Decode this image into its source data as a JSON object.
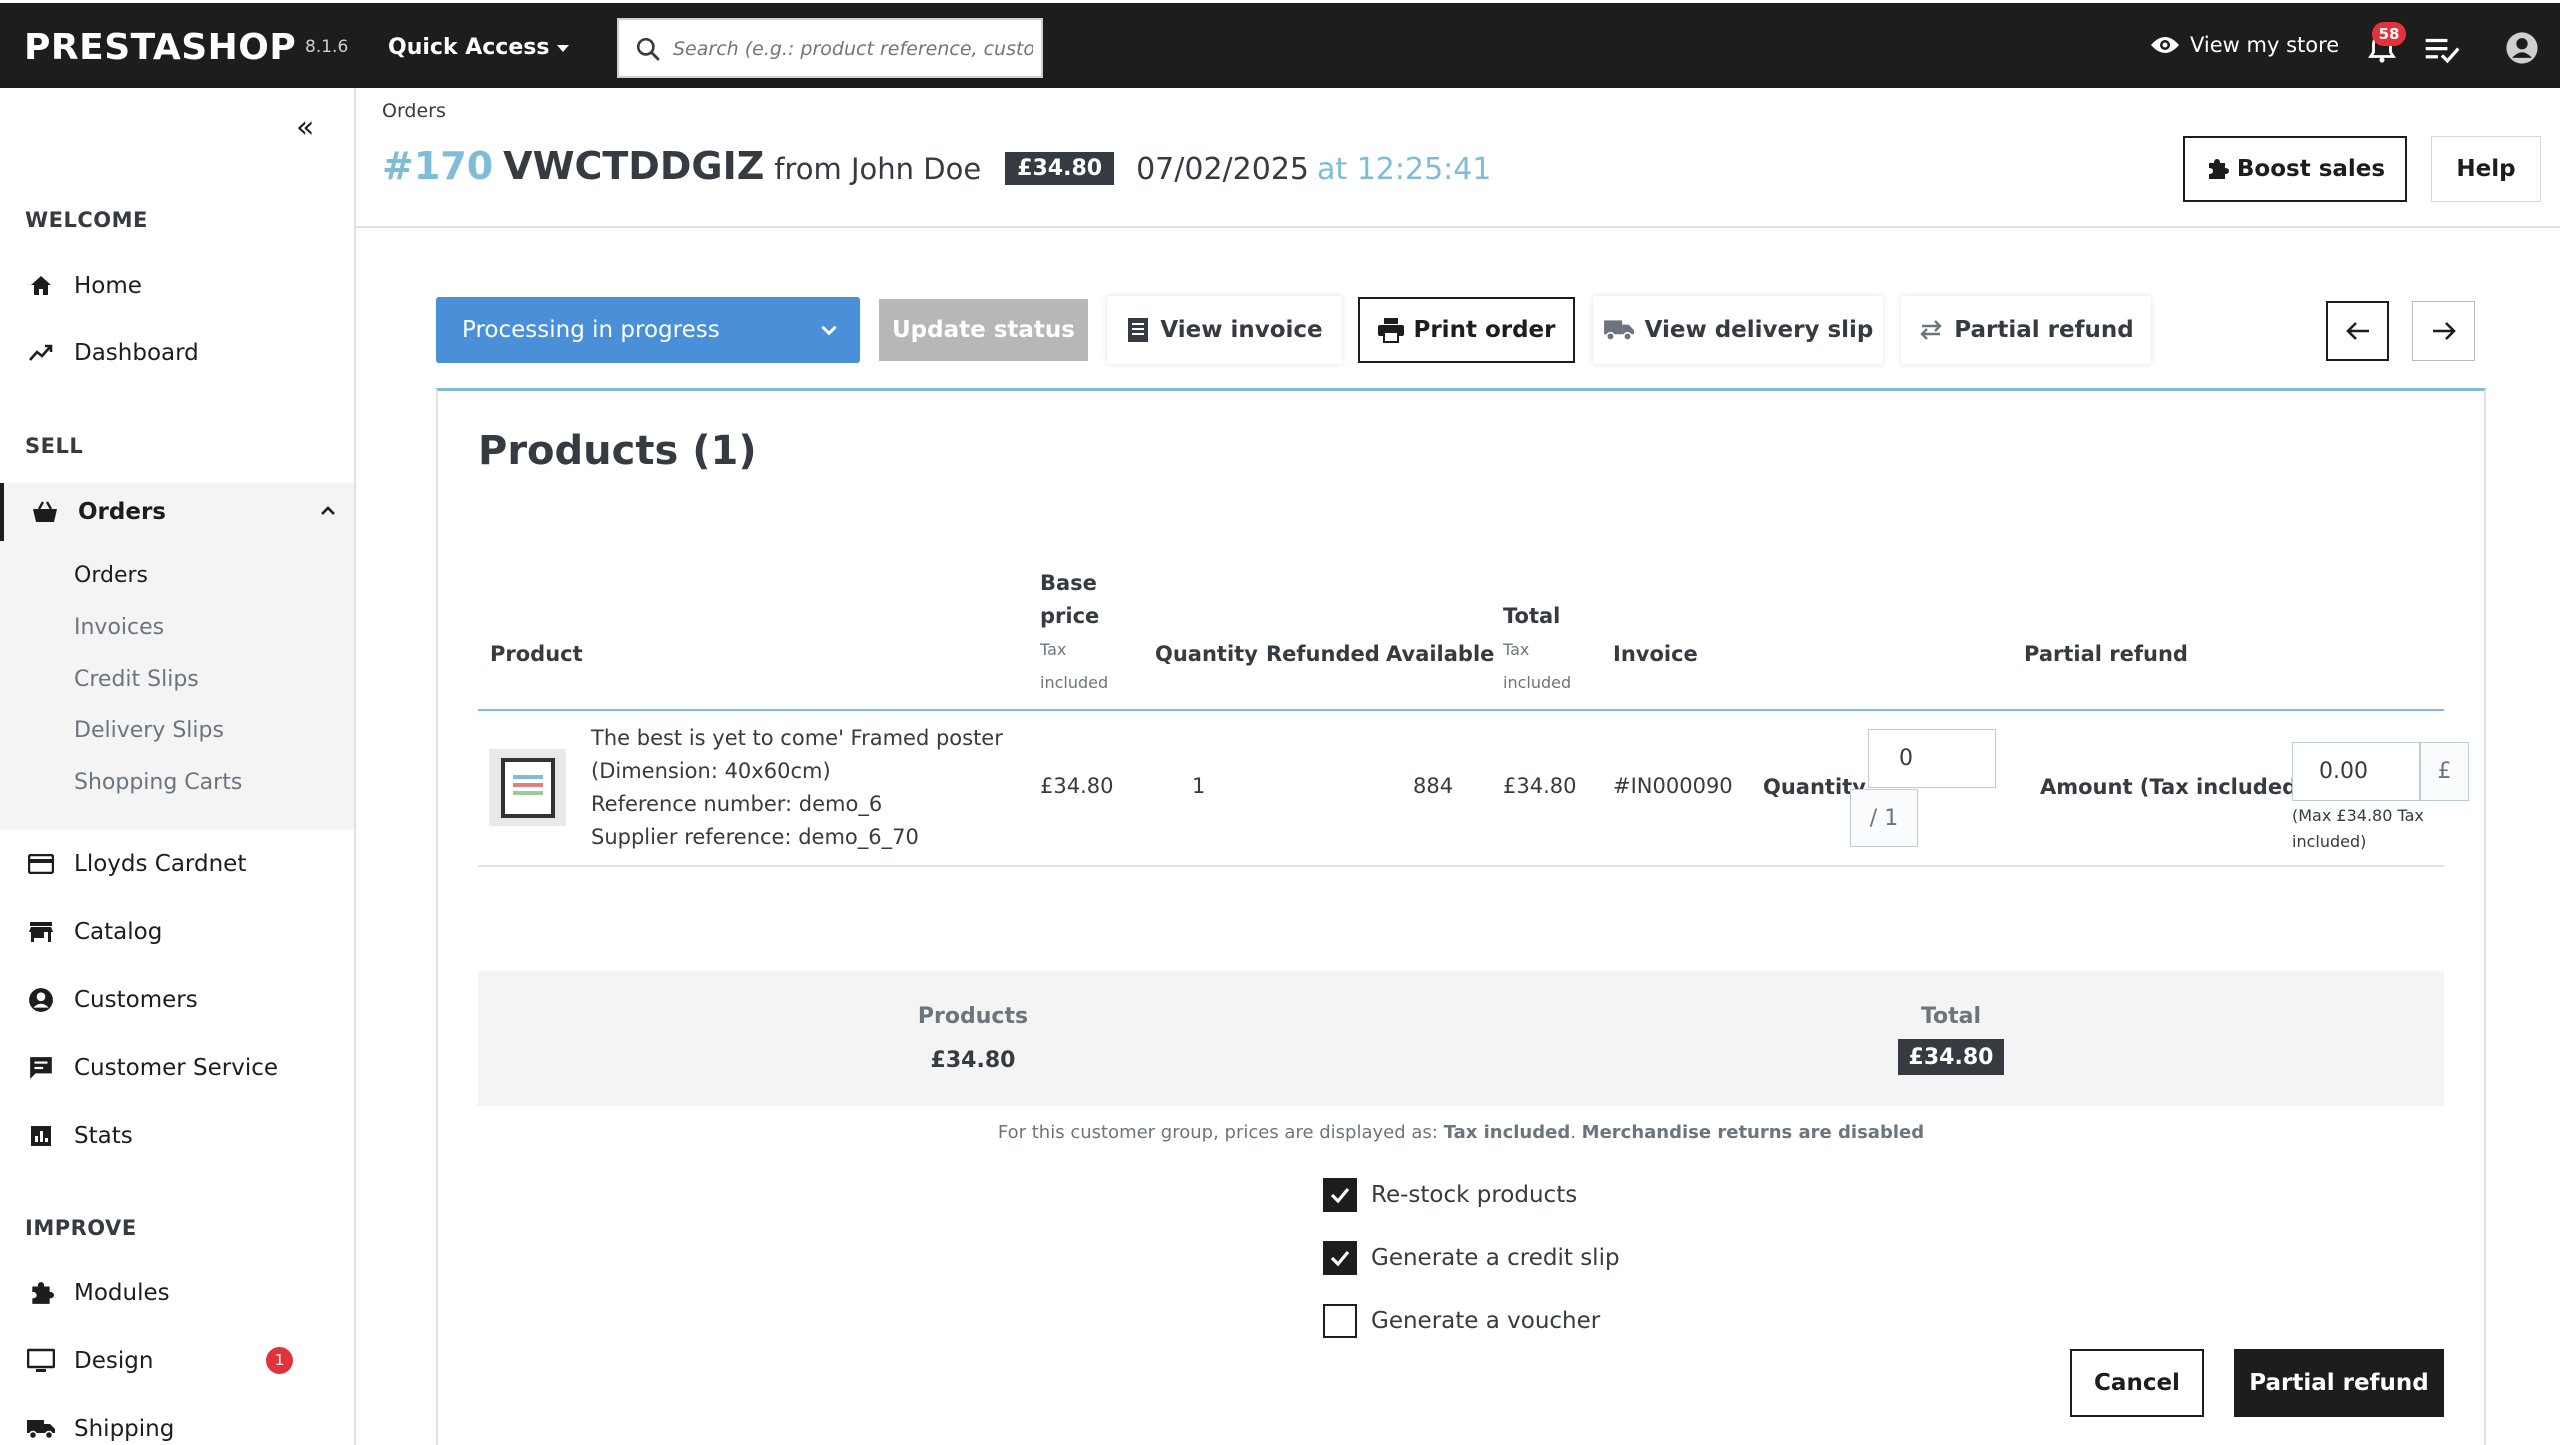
{
  "topbar": {
    "logo": "PRESTASHOP",
    "version": "8.1.6",
    "quick_access": "Quick Access",
    "search_placeholder": "Search (e.g.: product reference, custor",
    "view_store": "View my store",
    "notifications_count": "58"
  },
  "sidebar": {
    "sections": {
      "welcome": "WELCOME",
      "sell": "SELL",
      "improve": "IMPROVE"
    },
    "items": {
      "home": "Home",
      "dashboard": "Dashboard",
      "orders": "Orders",
      "lloyds": "Lloyds Cardnet",
      "catalog": "Catalog",
      "customers": "Customers",
      "customer_service": "Customer Service",
      "stats": "Stats",
      "modules": "Modules",
      "design": "Design",
      "design_badge": "1",
      "shipping": "Shipping"
    },
    "orders_sub": [
      "Orders",
      "Invoices",
      "Credit Slips",
      "Delivery Slips",
      "Shopping Carts"
    ]
  },
  "header": {
    "breadcrumb": "Orders",
    "order_number": "#170",
    "order_reference": "VWCTDDGIZ",
    "from_customer": "from John Doe",
    "total_badge": "£34.80",
    "date": "07/02/2025",
    "time": "at 12:25:41",
    "boost_sales": "Boost sales",
    "help": "Help"
  },
  "actions": {
    "status": "Processing in progress",
    "update_status": "Update status",
    "view_invoice": "View invoice",
    "print_order": "Print order",
    "view_delivery_slip": "View delivery slip",
    "partial_refund": "Partial refund"
  },
  "products": {
    "title": "Products (1)",
    "columns": {
      "product": "Product",
      "base_price_1": "Base",
      "base_price_2": "price",
      "base_price_sub_1": "Tax",
      "base_price_sub_2": "included",
      "quantity": "Quantity",
      "refunded": "Refunded",
      "available": "Available",
      "total": "Total",
      "total_sub_1": "Tax",
      "total_sub_2": "included",
      "invoice": "Invoice",
      "partial_refund": "Partial refund"
    },
    "rows": [
      {
        "name_lines": [
          "The best is yet to come' Framed poster",
          "(Dimension: 40x60cm)",
          "Reference number: demo_6",
          "Supplier reference: demo_6_70"
        ],
        "base_price": "£34.80",
        "quantity": "1",
        "refunded": "",
        "available": "884",
        "total": "£34.80",
        "invoice": "#IN000090",
        "qty_label": "Quantity",
        "qty_value": "0",
        "qty_max": "/ 1",
        "amount_label": "Amount (Tax included)",
        "amount_value": "0.00",
        "currency": "£",
        "amount_help": "(Max £34.80 Tax included)"
      }
    ]
  },
  "summary": {
    "products_label": "Products",
    "products_value": "£34.80",
    "total_label": "Total",
    "total_value": "£34.80",
    "note_prefix": "For this customer group, prices are displayed as:",
    "note_tax": "Tax included",
    "note_returns": "Merchandise returns are disabled"
  },
  "refund_options": {
    "restock": "Re-stock products",
    "restock_checked": true,
    "credit_slip": "Generate a credit slip",
    "credit_slip_checked": true,
    "voucher": "Generate a voucher",
    "voucher_checked": false
  },
  "footer_buttons": {
    "cancel": "Cancel",
    "partial_refund": "Partial refund"
  }
}
